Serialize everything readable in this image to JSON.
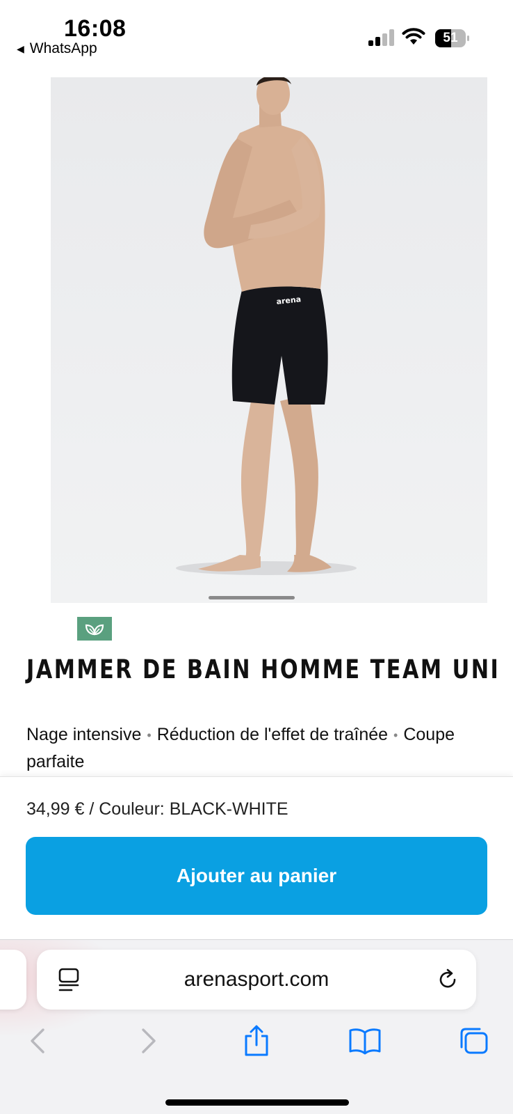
{
  "status_bar": {
    "time": "16:08",
    "back_app": "WhatsApp",
    "battery_level": "51"
  },
  "product": {
    "image_alt": "arena",
    "title": "JAMMER DE BAIN HOMME TEAM UNI",
    "features": [
      "Nage intensive",
      "Réduction de l'effet de traînée",
      "Coupe parfaite"
    ],
    "eco_badge_icon": "leaf-icon",
    "eco_badge_color": "#5aa07f"
  },
  "cart": {
    "price_line": "34,99 € / Couleur: BLACK-WHITE",
    "add_button_label": "Ajouter au panier",
    "accent_color": "#0aa0e2"
  },
  "browser": {
    "url": "arenasport.com",
    "toolbar_icons": [
      "back-icon",
      "forward-icon",
      "share-icon",
      "bookmarks-icon",
      "tabs-icon"
    ],
    "tint_color": "#0a7aff"
  }
}
